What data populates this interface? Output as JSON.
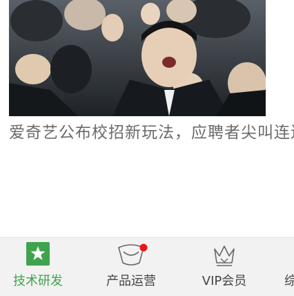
{
  "article": {
    "headline": "爱奇艺公布校招新玩法，应聘者尖叫连连"
  },
  "tabs": [
    {
      "label": "技术研发",
      "icon": "star-square-icon",
      "active": true
    },
    {
      "label": "产品运营",
      "icon": "chat-bubble-icon",
      "active": false,
      "has_notification": true
    },
    {
      "label": "VIP会员",
      "icon": "crown-icon",
      "active": false
    },
    {
      "label": "综",
      "icon": "",
      "active": false
    }
  ],
  "colors": {
    "active_green": "#3fa34d",
    "notification_red": "#e8151c",
    "tabbar_bg": "#f2f2f2"
  }
}
